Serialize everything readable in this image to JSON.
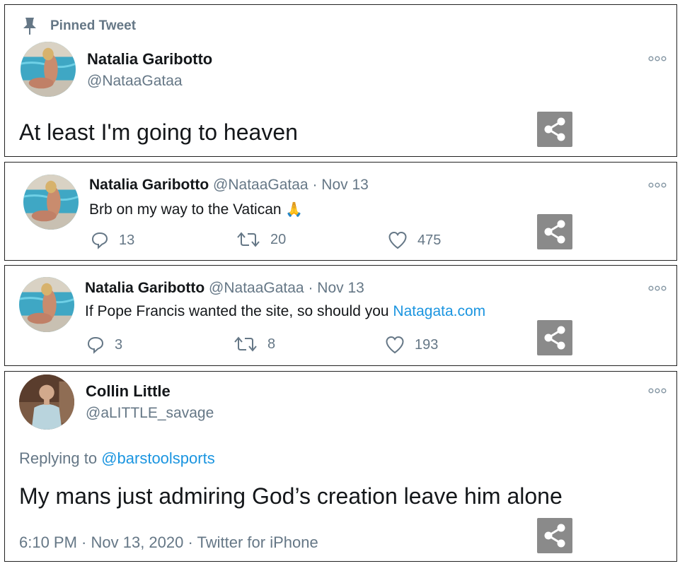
{
  "colors": {
    "link": "#1b95e0",
    "secondary": "#657786",
    "share_bg": "#8a8a8a"
  },
  "card1": {
    "pinned_label": "Pinned Tweet",
    "name": "Natalia Garibotto",
    "handle": "@NataaGataa",
    "text": "At least I'm going to heaven"
  },
  "card2": {
    "name": "Natalia Garibotto",
    "handle": "@NataaGataa",
    "sep": "·",
    "date": "Nov 13",
    "text": "Brb on my way to the Vatican",
    "emoji": "🙏",
    "replies": "13",
    "retweets": "20",
    "likes": "475"
  },
  "card3": {
    "name": "Natalia Garibotto",
    "handle": "@NataaGataa",
    "sep": "·",
    "date": "Nov 13",
    "text": "If Pope Francis wanted the site, so should you",
    "link": "Natagata.com",
    "replies": "3",
    "retweets": "8",
    "likes": "193"
  },
  "card4": {
    "name": "Collin Little",
    "handle": "@aLITTLE_savage",
    "replying_prefix": "Replying to",
    "replying_to": "@barstoolsports",
    "text": "My mans just admiring God’s creation leave him alone",
    "timestamp": "6:10 PM · Nov 13, 2020 · Twitter for iPhone"
  }
}
